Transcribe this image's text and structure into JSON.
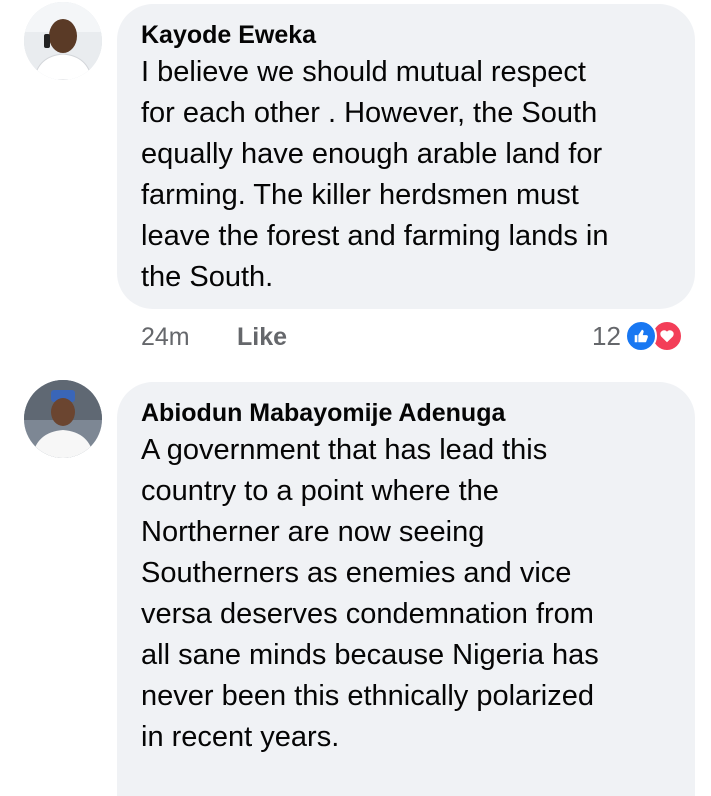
{
  "comments": [
    {
      "author": "Kayode Eweka",
      "text": "I believe we should mutual respect\nfor each other . However, the South\nequally have  enough arable land for\nfarming. The killer herdsmen must\nleave the forest and farming lands in\nthe South.",
      "time": "24m",
      "like_label": "Like",
      "reaction_count": "12"
    },
    {
      "author": "Abiodun Mabayomije Adenuga",
      "text": "A government that has lead this\ncountry to a point where the\nNortherner are now seeing\nSoutherners as enemies and vice\nversa deserves condemnation from\nall sane minds because Nigeria has\nnever been this ethnically polarized\nin recent years."
    }
  ],
  "colors": {
    "bubble": "#f0f2f5",
    "meta_text": "#65676b",
    "like_blue": "#1877f2",
    "love_red": "#f33e58"
  }
}
